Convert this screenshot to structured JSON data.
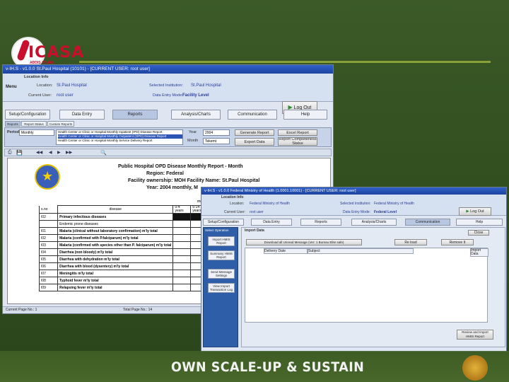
{
  "logo": {
    "text": "ICASA",
    "subtitle": "ADDIS ABABA ETHIOPIA"
  },
  "footer": {
    "tagline": "OWN SCALE-UP & SUSTAIN"
  },
  "colors": {
    "brand_red": "#c8102e",
    "slide_green": "#3b5a27",
    "accent_line": "#8aa13a",
    "titlebar_blue": "#2f61c9"
  },
  "window1": {
    "title": "v-IH.S - v1.0.0 St.Paul Hospital (10101) - [CURRENT USER: root user]",
    "menu_label": "Menu",
    "location_info_label": "Location Info",
    "location_label": "Location:",
    "location_value": "St.Paul Hospital",
    "current_user_label": "Current User:",
    "current_user_value": "root user",
    "selected_institution_label": "Selected Institution:",
    "selected_institution_value": "St.Paul Hospital",
    "data_entry_mode_label": "Data Entry Mode:",
    "data_entry_mode_value": "Facility Level",
    "logout_label": "Log Out",
    "tabs": [
      "Setup/Configuration",
      "Data Entry",
      "Reports",
      "Analysis/Charts",
      "Communication",
      "Help"
    ],
    "subtabs": [
      "Reports",
      "Report Status",
      "Custom Reports"
    ],
    "period_label": "Period",
    "period_value": "Monthly",
    "report_list": [
      "Health Center or Clinic or Hospital Monthly Inpatient (IPD) Disease Report",
      "Health Center or Clinic or Hospital Monthly Outpatient (OPD) Disease Report",
      "Health Center or Clinic or Hospital Monthly Service Delivery Report"
    ],
    "year_label": "Year",
    "year_value": "2004",
    "month_label": "Month",
    "month_value": "Tekemt",
    "generate_report_label": "Generate Report",
    "excel_report_label": "Excel Report",
    "export_data_label": "Export Data",
    "report_completeness_label": "Report Completeness Status",
    "report": {
      "title_line1": "Public Hospital OPD Disease Monthly Report - Month",
      "title_line2": "Region:  Federal",
      "title_line3": "Facility ownership: MOH  Facility Name: St.Paul Hospital",
      "title_line4": "Year: 2004       monthly, M",
      "header_male": "male",
      "header_sno": "s.no",
      "header_disease": "disease",
      "header_age1": "0-4",
      "header_age1b": "years",
      "header_age2": "5-14",
      "header_age2b": "years",
      "rows": [
        {
          "sno": "I02",
          "disease": "Primary infectious diseases"
        },
        {
          "sno": "",
          "disease": "Endemic prone diseases"
        },
        {
          "sno": "I01",
          "disease": "Malaria (clinical without laboratory confirmation) m'ly total"
        },
        {
          "sno": "I02",
          "disease": "Malaria (confirmed with P.falciparum) m'ly total"
        },
        {
          "sno": "I03",
          "disease": "Malaria (confirmed with species other than P. falciparum) m'ly total"
        },
        {
          "sno": "I04",
          "disease": "Diarrhea (non bloody) m'ly total"
        },
        {
          "sno": "I05",
          "disease": "Diarrhea with dehydration m'ly total"
        },
        {
          "sno": "I06",
          "disease": "Diarrhea with blood (dysentery) m'ly total"
        },
        {
          "sno": "I07",
          "disease": "Meningitis m'ly total"
        },
        {
          "sno": "I08",
          "disease": "Typhoid fever m'ly total"
        },
        {
          "sno": "I09",
          "disease": "Relapsing fever m'ly total"
        }
      ]
    },
    "status_current_page": "Current Page No.: 1",
    "status_total_page": "Total Page No.: 14"
  },
  "window2": {
    "title": "v-IH.S - v1.0.0 Federal Ministry of Health (1.0001.10001) - [CURRENT USER: root user]",
    "location_info_label": "Location Info",
    "location_label": "Location:",
    "location_value": "Federal Ministry of Health",
    "current_user_label": "Current User:",
    "current_user_value": "root user",
    "selected_institution_label": "Selected Institution:",
    "selected_institution_value": "Federal Ministry of Health",
    "data_entry_mode_label": "Data Entry Mode:",
    "data_entry_mode_value": "Federal Level",
    "logout_label": "Log Out",
    "tabs": [
      "Setup/Configuration",
      "Data Entry",
      "Reports",
      "Analysis/Charts",
      "Communication",
      "Help"
    ],
    "sidebar_header": "Select Operation",
    "sidebar_buttons": [
      "Import HMIS Report",
      "Summary HMIS Report",
      "Send Message Settings",
      "View Import Transaction Log"
    ],
    "section_title": "Import Data",
    "close_label": "Close",
    "download_label": "Download all Unread Message (Ver: 1 Bureau Elite safe)",
    "reload_label": "Re load",
    "remove_label": "Remove It",
    "grid_headers": [
      "Delivery Date",
      "Subject",
      "Import Data"
    ],
    "bottom_button_label": "Review and Import HMIS Report"
  }
}
